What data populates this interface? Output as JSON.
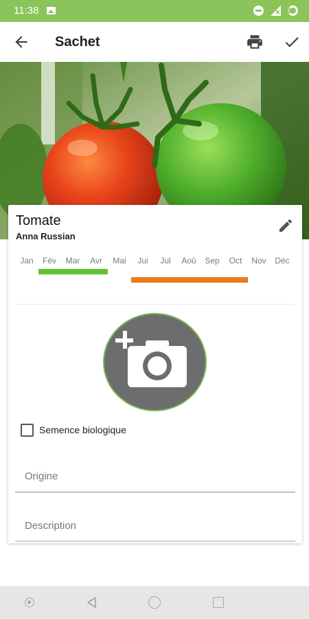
{
  "status_bar": {
    "time": "11:38",
    "icons": [
      "image-icon",
      "do-not-disturb-icon",
      "signal-icon",
      "battery-icon"
    ]
  },
  "app_bar": {
    "title": "Sachet",
    "icons": [
      "back-arrow-icon",
      "print-icon",
      "check-icon"
    ]
  },
  "hero": {
    "subject": "tomato-photo"
  },
  "card": {
    "name": "Tomate",
    "variety": "Anna Russian",
    "months": [
      "Jan",
      "Fév",
      "Mar",
      "Avr",
      "Mai",
      "Jui",
      "Jul",
      "Aoû",
      "Sep",
      "Oct",
      "Nov",
      "Déc"
    ],
    "sowing_color": "#66c133",
    "harvest_color": "#ea7b1d",
    "organic_label": "Semence biologique",
    "organic_checked": false,
    "origin_placeholder": "Origine",
    "description_placeholder": "Description"
  },
  "nav_bar": {
    "icons": [
      "assistant-icon",
      "nav-back-icon",
      "nav-home-icon",
      "nav-recents-icon"
    ]
  },
  "colors": {
    "accent": "#8bc45b",
    "photo_circle": "#6d6d6d",
    "photo_ring": "#76b852"
  }
}
